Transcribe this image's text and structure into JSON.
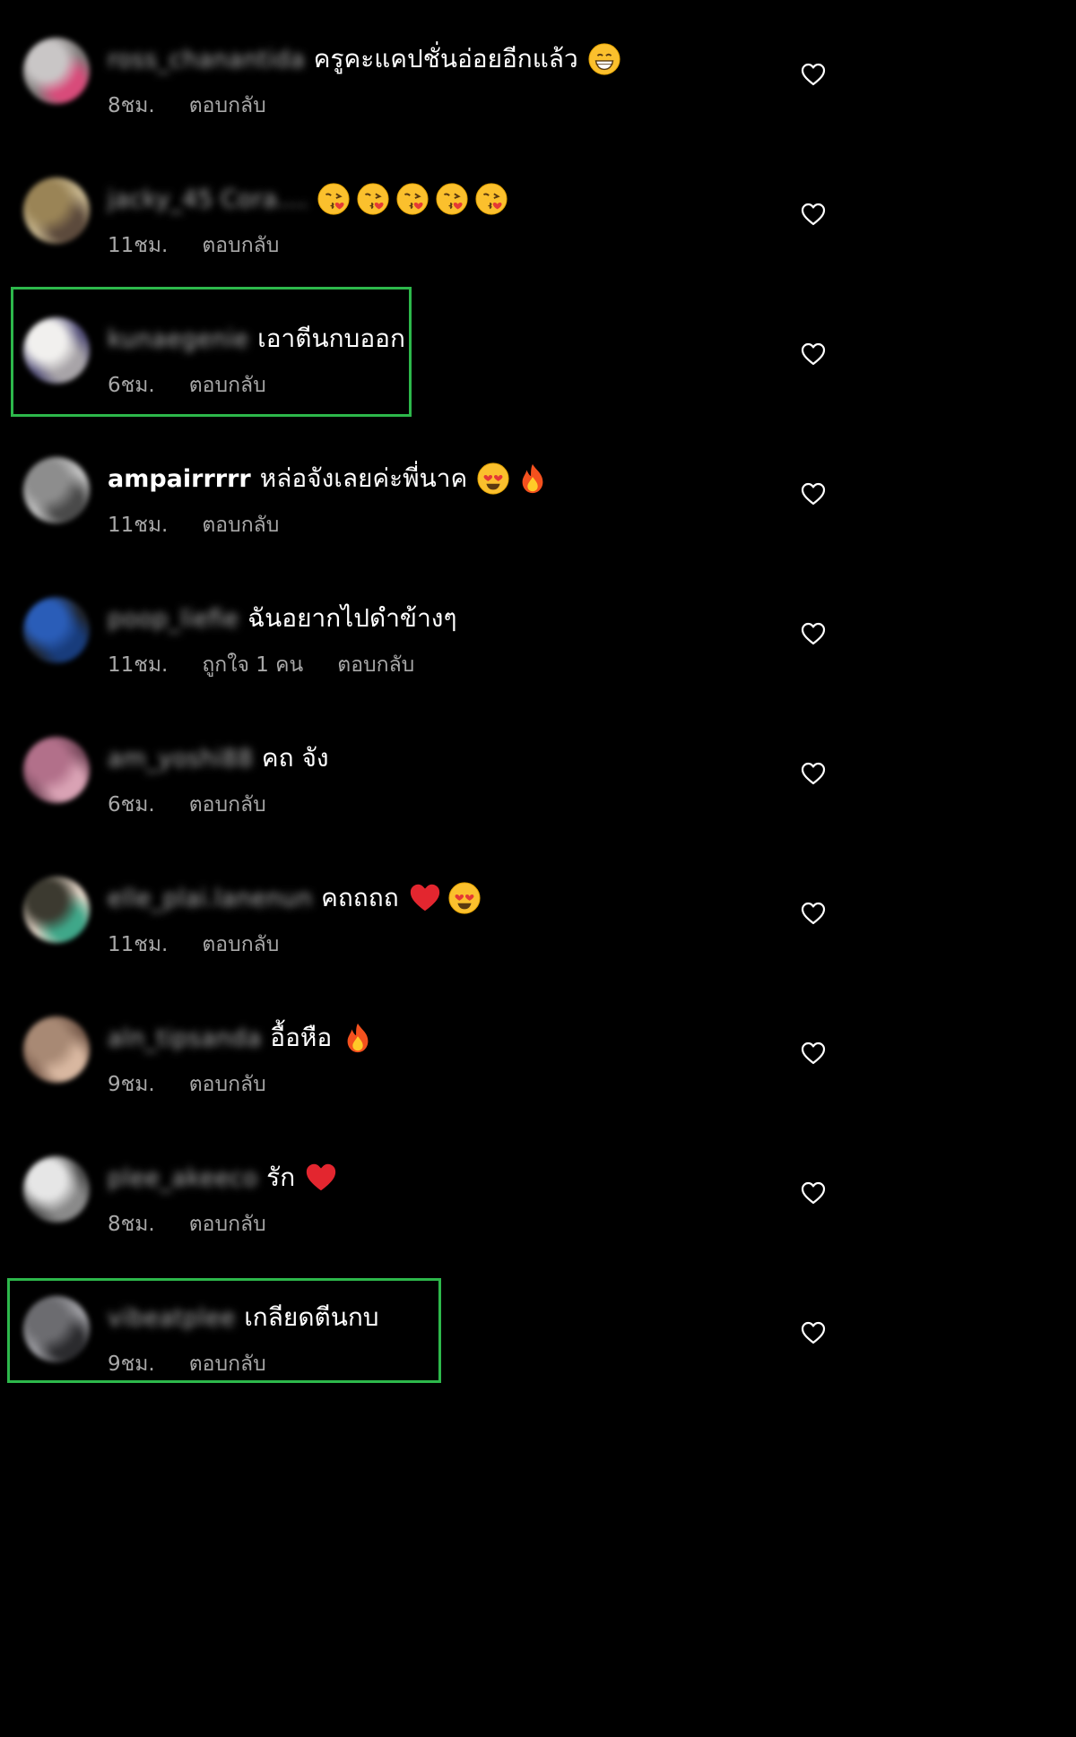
{
  "colors": {
    "background": "#000000",
    "text": "#ffffff",
    "meta": "#a8a8a8",
    "highlight": "#2db84b"
  },
  "comments": [
    {
      "username": "ross_chanantida",
      "username_blurred": true,
      "text": "ครูคะแคปชั่นอ่อยอีกแล้ว",
      "emojis": [
        "grinning-face-icon"
      ],
      "time": "8ชม.",
      "likes": "",
      "reply": "ตอบกลับ",
      "avatar_colors": [
        "#c9c6c6",
        "#d84b7a",
        "#7e7a79"
      ],
      "highlighted": false
    },
    {
      "username": "jacky_45 Cora....",
      "username_blurred": true,
      "text": "",
      "emojis": [
        "kissing-face-icon",
        "kissing-face-icon",
        "kissing-face-icon",
        "kissing-face-icon",
        "kissing-face-icon"
      ],
      "time": "11ชม.",
      "likes": "",
      "reply": "ตอบกลับ",
      "avatar_colors": [
        "#9a8456",
        "#5c4a3c",
        "#c6b58e"
      ],
      "highlighted": false
    },
    {
      "username": "kunaegenie",
      "username_blurred": true,
      "text": "เอาตีนกบออก",
      "emojis": [],
      "time": "6ชม.",
      "likes": "",
      "reply": "ตอบกลับ",
      "avatar_colors": [
        "#f1f0ee",
        "#a8a4a8",
        "#55517a"
      ],
      "highlighted": true
    },
    {
      "username": "ampairrrrr",
      "username_blurred": false,
      "text": "หล่อจังเลยค่ะพี่นาค",
      "emojis": [
        "heart-eyes-face-icon",
        "fire-icon"
      ],
      "time": "11ชม.",
      "likes": "",
      "reply": "ตอบกลับ",
      "avatar_colors": [
        "#8d8d8d",
        "#4a4a4a",
        "#c3c3c3"
      ],
      "highlighted": false
    },
    {
      "username": "poop_liefie",
      "username_blurred": true,
      "text": "ฉันอยากไปดำข้างๆ",
      "emojis": [],
      "time": "11ชม.",
      "likes": "ถูกใจ 1 คน",
      "reply": "ตอบกลับ",
      "avatar_colors": [
        "#2a5db8",
        "#183c7c",
        "#1f232b"
      ],
      "highlighted": false
    },
    {
      "username": "am_yoshi88",
      "username_blurred": true,
      "text": "คถ จัง",
      "emojis": [],
      "time": "6ชม.",
      "likes": "",
      "reply": "ตอบกลับ",
      "avatar_colors": [
        "#b2708a",
        "#d9a2b4",
        "#7b4c5f"
      ],
      "highlighted": false
    },
    {
      "username": "elle_plai.lanenun",
      "username_blurred": true,
      "text": "คถถถถ",
      "emojis": [
        "red-heart-icon",
        "heart-eyes-face-icon"
      ],
      "time": "11ชม.",
      "likes": "",
      "reply": "ตอบกลับ",
      "avatar_colors": [
        "#3c3a30",
        "#3fa789",
        "#e4d6c8"
      ],
      "highlighted": false
    },
    {
      "username": "aln_tipsanda",
      "username_blurred": true,
      "text": "อื้อหือ",
      "emojis": [
        "fire-icon"
      ],
      "time": "9ชม.",
      "likes": "",
      "reply": "ตอบกลับ",
      "avatar_colors": [
        "#a88974",
        "#d8b7a0",
        "#7c5f4f"
      ],
      "highlighted": false
    },
    {
      "username": "plee_akeeco",
      "username_blurred": true,
      "text": "รัก",
      "emojis": [
        "red-heart-icon"
      ],
      "time": "8ชม.",
      "likes": "",
      "reply": "ตอบกลับ",
      "avatar_colors": [
        "#e6e6e6",
        "#8a8a8a",
        "#4c4c4c"
      ],
      "highlighted": false
    },
    {
      "username": "vibeatplee",
      "username_blurred": true,
      "text": "เกลียดตีนกบ",
      "emojis": [],
      "time": "9ชม.",
      "likes": "",
      "reply": "ตอบกลับ",
      "avatar_colors": [
        "#6c6c70",
        "#2b2b2e",
        "#9d9da2"
      ],
      "highlighted": true
    }
  ]
}
